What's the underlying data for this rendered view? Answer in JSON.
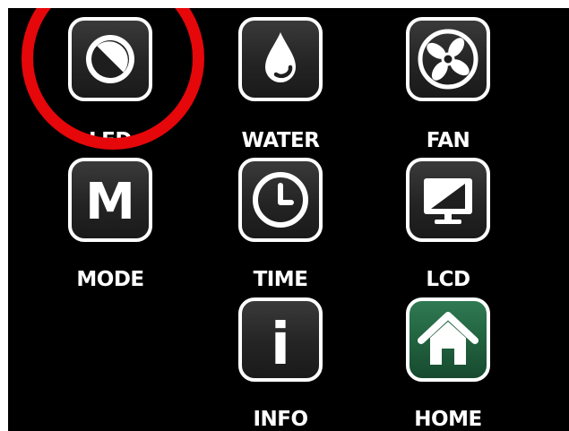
{
  "menu": {
    "led": {
      "label": "LED",
      "icon": "brightness-icon"
    },
    "water": {
      "label": "WATER",
      "icon": "water-drop-icon"
    },
    "fan": {
      "label": "FAN",
      "icon": "fan-icon"
    },
    "mode": {
      "label": "MODE",
      "icon": "letter-m-icon",
      "glyph": "M"
    },
    "time": {
      "label": "TIME",
      "icon": "clock-icon"
    },
    "lcd": {
      "label": "LCD",
      "icon": "monitor-icon"
    },
    "info": {
      "label": "INFO",
      "icon": "info-icon",
      "glyph": "i"
    },
    "home": {
      "label": "HOME",
      "icon": "home-icon"
    }
  },
  "colors": {
    "background": "#000000",
    "tile": "#2a2a2a",
    "tile_border": "#ffffff",
    "home_tile": "#1f5e3c",
    "highlight_ring": "#e6070b"
  },
  "highlighted_item": "LED"
}
